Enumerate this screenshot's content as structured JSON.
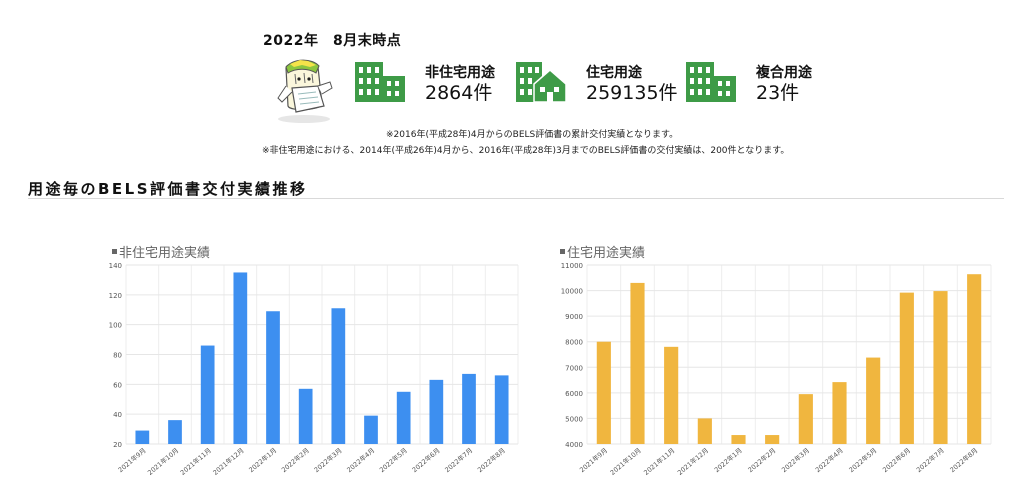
{
  "summary": {
    "as_of": "2022年　8月末時点",
    "stats": [
      {
        "label": "非住宅用途",
        "count": "2864件",
        "icon": "office-building-icon"
      },
      {
        "label": "住宅用途",
        "count": "259135件",
        "icon": "house-building-icon"
      },
      {
        "label": "複合用途",
        "count": "23件",
        "icon": "office-building-icon"
      }
    ],
    "notes": [
      "※2016年(平成28年)4月からのBELS評価書の累計交付実績となります。",
      "※非住宅用途における、2014年(平成26年)4月から、2016年(平成28年)3月までのBELS評価書の交付実績は、200件となります。"
    ],
    "colors": {
      "icon": "#3e9b47",
      "rule": "#d9d9d9"
    }
  },
  "section": {
    "title": "用途毎のBELS評価書交付実績推移"
  },
  "chart_data": [
    {
      "type": "bar",
      "title": "非住宅用途実績",
      "categories": [
        "2021年9月",
        "2021年10月",
        "2021年11月",
        "2021年12月",
        "2022年1月",
        "2022年2月",
        "2022年3月",
        "2022年4月",
        "2022年5月",
        "2022年6月",
        "2022年7月",
        "2022年8月"
      ],
      "values": [
        29,
        36,
        86,
        135,
        109,
        57,
        111,
        39,
        55,
        63,
        67,
        66
      ],
      "ylim": [
        20,
        140
      ],
      "yticks": [
        20,
        40,
        60,
        80,
        100,
        120,
        140
      ],
      "grid": true,
      "color": "#3d8ff0"
    },
    {
      "type": "bar",
      "title": "住宅用途実績",
      "categories": [
        "2021年9月",
        "2021年10月",
        "2021年11月",
        "2021年12月",
        "2022年1月",
        "2022年2月",
        "2022年3月",
        "2022年4月",
        "2022年5月",
        "2022年6月",
        "2022年7月",
        "2022年8月"
      ],
      "values": [
        8000,
        10300,
        7800,
        5000,
        4350,
        4350,
        5950,
        6420,
        7380,
        9920,
        9980,
        10640
      ],
      "ylim": [
        4000,
        11000
      ],
      "yticks": [
        4000,
        5000,
        6000,
        7000,
        8000,
        9000,
        10000,
        11000
      ],
      "grid": true,
      "color": "#f0b63f"
    }
  ]
}
